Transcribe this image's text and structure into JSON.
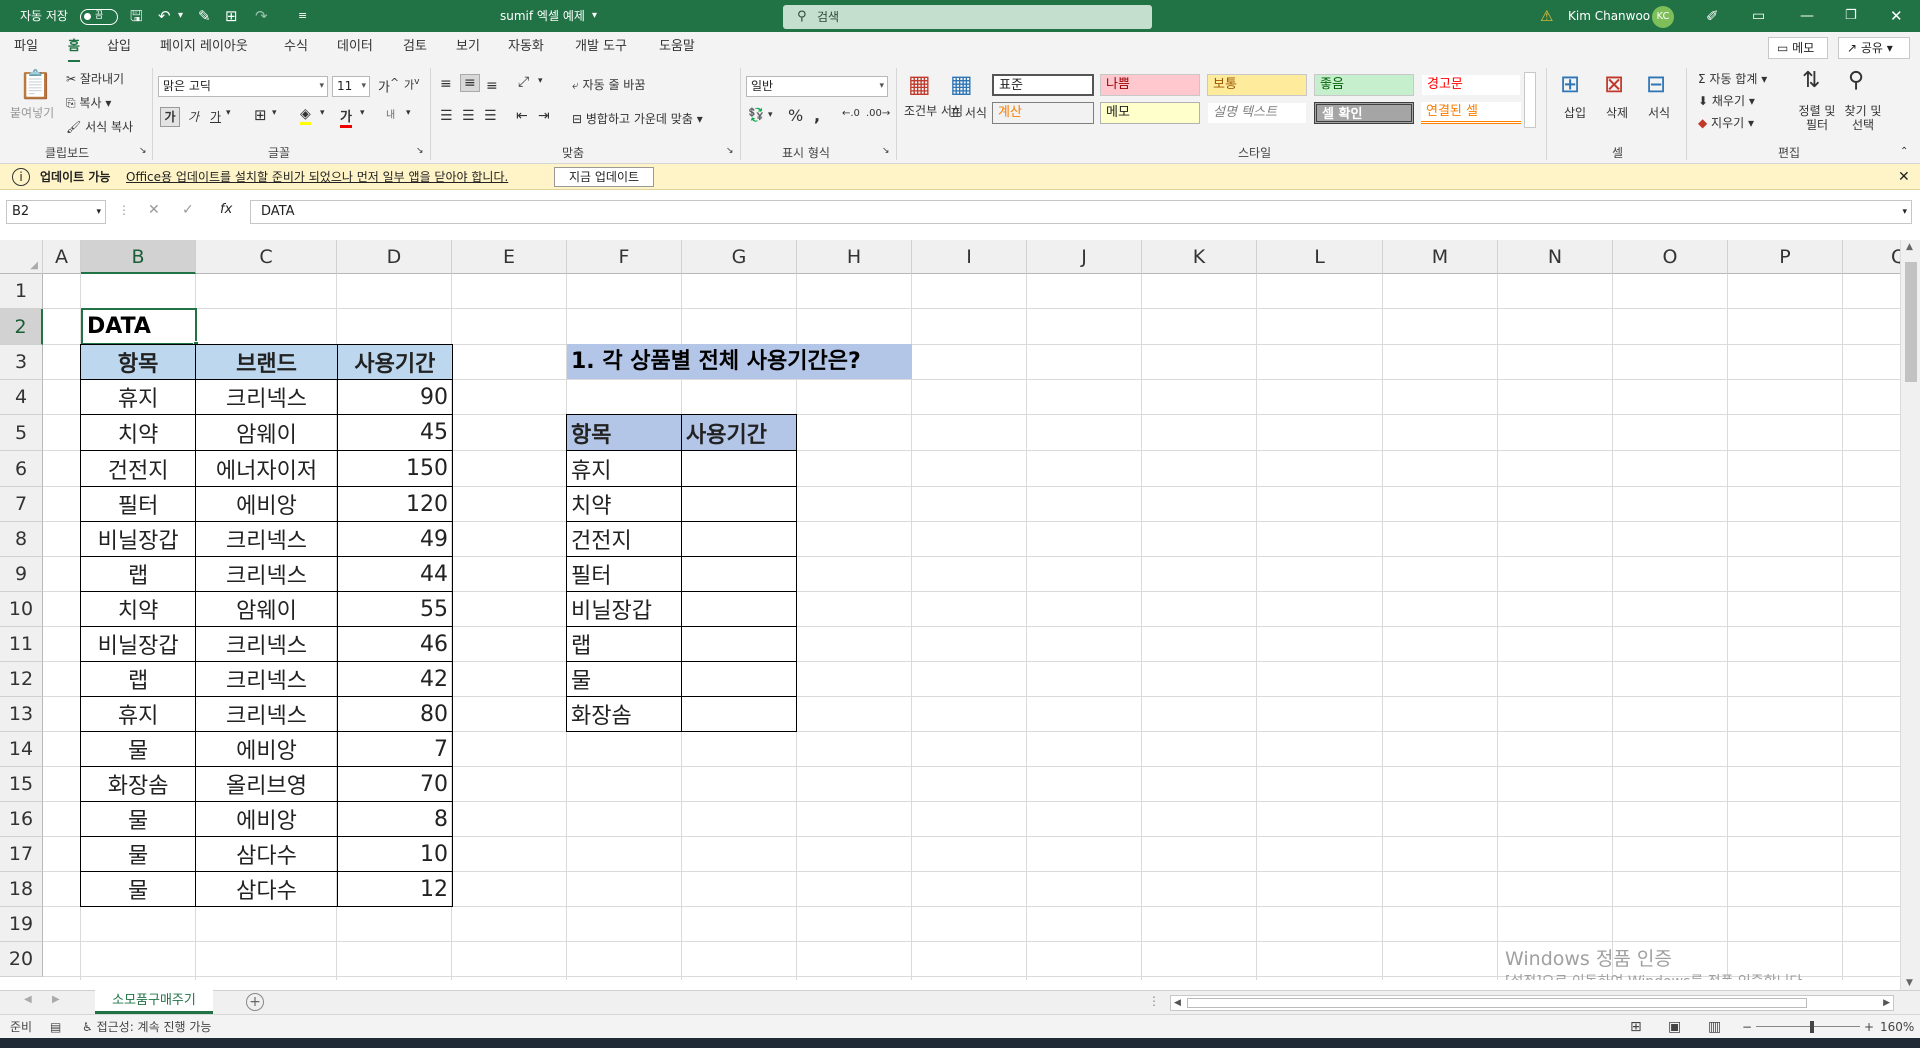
{
  "titlebar": {
    "autosave_label": "자동 저장",
    "autosave_state": "끔",
    "doc_title": "sumif 엑셀 예제",
    "search_placeholder": "검색",
    "user_name": "Kim Chanwoo",
    "user_initials": "KC"
  },
  "menu": {
    "tabs": [
      "파일",
      "홈",
      "삽입",
      "페이지 레이아웃",
      "수식",
      "데이터",
      "검토",
      "보기",
      "자동화",
      "개발 도구",
      "도움말"
    ],
    "active_tab": "홈",
    "memo_button": "메모",
    "share_button": "공유"
  },
  "ribbon": {
    "clipboard": {
      "paste": "붙여넣기",
      "cut": "잘라내기",
      "copy": "복사",
      "format_painter": "서식 복사",
      "group": "클립보드"
    },
    "font": {
      "name": "맑은 고딕",
      "size": "11",
      "bold": "가",
      "italic": "가",
      "underline": "가",
      "group": "글꼴"
    },
    "align": {
      "wrap": "자동 줄 바꿈",
      "merge": "병합하고 가운데 맞춤",
      "group": "맞춤"
    },
    "number": {
      "format": "일반",
      "group": "표시 형식"
    },
    "styles": {
      "conditional": "조건부 서식",
      "table": "표 서식",
      "cells": [
        "표준",
        "나쁨",
        "보통",
        "좋음",
        "경고문",
        "계산",
        "메모",
        "설명 텍스트",
        "셀 확인",
        "연결된 셀"
      ],
      "group": "스타일"
    },
    "cells": {
      "insert": "삽입",
      "delete": "삭제",
      "format": "서식",
      "group": "셀"
    },
    "editing": {
      "autosum": "자동 합계",
      "fill": "채우기",
      "clear": "지우기",
      "sort": "정렬 및 필터",
      "find": "찾기 및 선택",
      "group": "편집"
    }
  },
  "infobar": {
    "title": "업데이트 가능",
    "message": "Office용 업데이트를 설치할 준비가 되었으나 먼저 일부 앱을 닫아야 합니다.",
    "button": "지금 업데이트"
  },
  "formula_bar": {
    "name_box": "B2",
    "fx": "fx",
    "value": "DATA"
  },
  "grid": {
    "columns": [
      "A",
      "B",
      "C",
      "D",
      "E",
      "F",
      "G",
      "H",
      "I",
      "J",
      "K",
      "L",
      "M",
      "N",
      "O",
      "P",
      "Q"
    ],
    "rows": [
      "1",
      "2",
      "3",
      "4",
      "5",
      "6",
      "7",
      "8",
      "9",
      "10",
      "11",
      "12",
      "13",
      "14",
      "15",
      "16",
      "17",
      "18",
      "19",
      "20"
    ],
    "selected_cell": "B2"
  },
  "data_table": {
    "title": "DATA",
    "headers": [
      "항목",
      "브랜드",
      "사용기간"
    ],
    "rows": [
      [
        "휴지",
        "크리넥스",
        "90"
      ],
      [
        "치약",
        "암웨이",
        "45"
      ],
      [
        "건전지",
        "에너자이저",
        "150"
      ],
      [
        "필터",
        "에비앙",
        "120"
      ],
      [
        "비닐장갑",
        "크리넥스",
        "49"
      ],
      [
        "랩",
        "크리넥스",
        "44"
      ],
      [
        "치약",
        "암웨이",
        "55"
      ],
      [
        "비닐장갑",
        "크리넥스",
        "46"
      ],
      [
        "랩",
        "크리넥스",
        "42"
      ],
      [
        "휴지",
        "크리넥스",
        "80"
      ],
      [
        "물",
        "에비앙",
        "7"
      ],
      [
        "화장솜",
        "올리브영",
        "70"
      ],
      [
        "물",
        "에비앙",
        "8"
      ],
      [
        "물",
        "삼다수",
        "10"
      ],
      [
        "물",
        "삼다수",
        "12"
      ]
    ]
  },
  "question": {
    "title": "1. 각 상품별 전체 사용기간은?",
    "headers": [
      "항목",
      "사용기간"
    ],
    "items": [
      "휴지",
      "치약",
      "건전지",
      "필터",
      "비닐장갑",
      "랩",
      "물",
      "화장솜"
    ]
  },
  "watermark": {
    "line1": "Windows 정품 인증",
    "line2": "[설정]으로 이동하여 Windows를 정품 인증합니다."
  },
  "sheet": {
    "tab": "소모품구매주기"
  },
  "status": {
    "ready": "준비",
    "accessibility": "접근성: 계속 진행 가능",
    "zoom": "160%"
  },
  "colors": {
    "excel_green": "#217346",
    "header_blue": "#bdd7ee",
    "question_blue": "#b4c6e7",
    "info_yellow": "#fff4c7"
  }
}
